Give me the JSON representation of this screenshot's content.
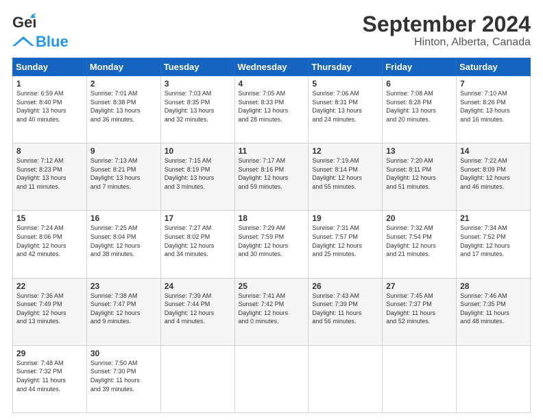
{
  "header": {
    "logo_line1": "General",
    "logo_line2": "Blue",
    "title": "September 2024",
    "subtitle": "Hinton, Alberta, Canada"
  },
  "columns": [
    "Sunday",
    "Monday",
    "Tuesday",
    "Wednesday",
    "Thursday",
    "Friday",
    "Saturday"
  ],
  "weeks": [
    [
      {
        "day": "1",
        "lines": [
          "Sunrise: 6:59 AM",
          "Sunset: 8:40 PM",
          "Daylight: 13 hours",
          "and 40 minutes."
        ]
      },
      {
        "day": "2",
        "lines": [
          "Sunrise: 7:01 AM",
          "Sunset: 8:38 PM",
          "Daylight: 13 hours",
          "and 36 minutes."
        ]
      },
      {
        "day": "3",
        "lines": [
          "Sunrise: 7:03 AM",
          "Sunset: 8:35 PM",
          "Daylight: 13 hours",
          "and 32 minutes."
        ]
      },
      {
        "day": "4",
        "lines": [
          "Sunrise: 7:05 AM",
          "Sunset: 8:33 PM",
          "Daylight: 13 hours",
          "and 28 minutes."
        ]
      },
      {
        "day": "5",
        "lines": [
          "Sunrise: 7:06 AM",
          "Sunset: 8:31 PM",
          "Daylight: 13 hours",
          "and 24 minutes."
        ]
      },
      {
        "day": "6",
        "lines": [
          "Sunrise: 7:08 AM",
          "Sunset: 8:28 PM",
          "Daylight: 13 hours",
          "and 20 minutes."
        ]
      },
      {
        "day": "7",
        "lines": [
          "Sunrise: 7:10 AM",
          "Sunset: 8:26 PM",
          "Daylight: 13 hours",
          "and 16 minutes."
        ]
      }
    ],
    [
      {
        "day": "8",
        "lines": [
          "Sunrise: 7:12 AM",
          "Sunset: 8:23 PM",
          "Daylight: 13 hours",
          "and 11 minutes."
        ]
      },
      {
        "day": "9",
        "lines": [
          "Sunrise: 7:13 AM",
          "Sunset: 8:21 PM",
          "Daylight: 13 hours",
          "and 7 minutes."
        ]
      },
      {
        "day": "10",
        "lines": [
          "Sunrise: 7:15 AM",
          "Sunset: 8:19 PM",
          "Daylight: 13 hours",
          "and 3 minutes."
        ]
      },
      {
        "day": "11",
        "lines": [
          "Sunrise: 7:17 AM",
          "Sunset: 8:16 PM",
          "Daylight: 12 hours",
          "and 59 minutes."
        ]
      },
      {
        "day": "12",
        "lines": [
          "Sunrise: 7:19 AM",
          "Sunset: 8:14 PM",
          "Daylight: 12 hours",
          "and 55 minutes."
        ]
      },
      {
        "day": "13",
        "lines": [
          "Sunrise: 7:20 AM",
          "Sunset: 8:11 PM",
          "Daylight: 12 hours",
          "and 51 minutes."
        ]
      },
      {
        "day": "14",
        "lines": [
          "Sunrise: 7:22 AM",
          "Sunset: 8:09 PM",
          "Daylight: 12 hours",
          "and 46 minutes."
        ]
      }
    ],
    [
      {
        "day": "15",
        "lines": [
          "Sunrise: 7:24 AM",
          "Sunset: 8:06 PM",
          "Daylight: 12 hours",
          "and 42 minutes."
        ]
      },
      {
        "day": "16",
        "lines": [
          "Sunrise: 7:25 AM",
          "Sunset: 8:04 PM",
          "Daylight: 12 hours",
          "and 38 minutes."
        ]
      },
      {
        "day": "17",
        "lines": [
          "Sunrise: 7:27 AM",
          "Sunset: 8:02 PM",
          "Daylight: 12 hours",
          "and 34 minutes."
        ]
      },
      {
        "day": "18",
        "lines": [
          "Sunrise: 7:29 AM",
          "Sunset: 7:59 PM",
          "Daylight: 12 hours",
          "and 30 minutes."
        ]
      },
      {
        "day": "19",
        "lines": [
          "Sunrise: 7:31 AM",
          "Sunset: 7:57 PM",
          "Daylight: 12 hours",
          "and 25 minutes."
        ]
      },
      {
        "day": "20",
        "lines": [
          "Sunrise: 7:32 AM",
          "Sunset: 7:54 PM",
          "Daylight: 12 hours",
          "and 21 minutes."
        ]
      },
      {
        "day": "21",
        "lines": [
          "Sunrise: 7:34 AM",
          "Sunset: 7:52 PM",
          "Daylight: 12 hours",
          "and 17 minutes."
        ]
      }
    ],
    [
      {
        "day": "22",
        "lines": [
          "Sunrise: 7:36 AM",
          "Sunset: 7:49 PM",
          "Daylight: 12 hours",
          "and 13 minutes."
        ]
      },
      {
        "day": "23",
        "lines": [
          "Sunrise: 7:38 AM",
          "Sunset: 7:47 PM",
          "Daylight: 12 hours",
          "and 9 minutes."
        ]
      },
      {
        "day": "24",
        "lines": [
          "Sunrise: 7:39 AM",
          "Sunset: 7:44 PM",
          "Daylight: 12 hours",
          "and 4 minutes."
        ]
      },
      {
        "day": "25",
        "lines": [
          "Sunrise: 7:41 AM",
          "Sunset: 7:42 PM",
          "Daylight: 12 hours",
          "and 0 minutes."
        ]
      },
      {
        "day": "26",
        "lines": [
          "Sunrise: 7:43 AM",
          "Sunset: 7:39 PM",
          "Daylight: 11 hours",
          "and 56 minutes."
        ]
      },
      {
        "day": "27",
        "lines": [
          "Sunrise: 7:45 AM",
          "Sunset: 7:37 PM",
          "Daylight: 11 hours",
          "and 52 minutes."
        ]
      },
      {
        "day": "28",
        "lines": [
          "Sunrise: 7:46 AM",
          "Sunset: 7:35 PM",
          "Daylight: 11 hours",
          "and 48 minutes."
        ]
      }
    ],
    [
      {
        "day": "29",
        "lines": [
          "Sunrise: 7:48 AM",
          "Sunset: 7:32 PM",
          "Daylight: 11 hours",
          "and 44 minutes."
        ]
      },
      {
        "day": "30",
        "lines": [
          "Sunrise: 7:50 AM",
          "Sunset: 7:30 PM",
          "Daylight: 11 hours",
          "and 39 minutes."
        ]
      },
      null,
      null,
      null,
      null,
      null
    ]
  ]
}
